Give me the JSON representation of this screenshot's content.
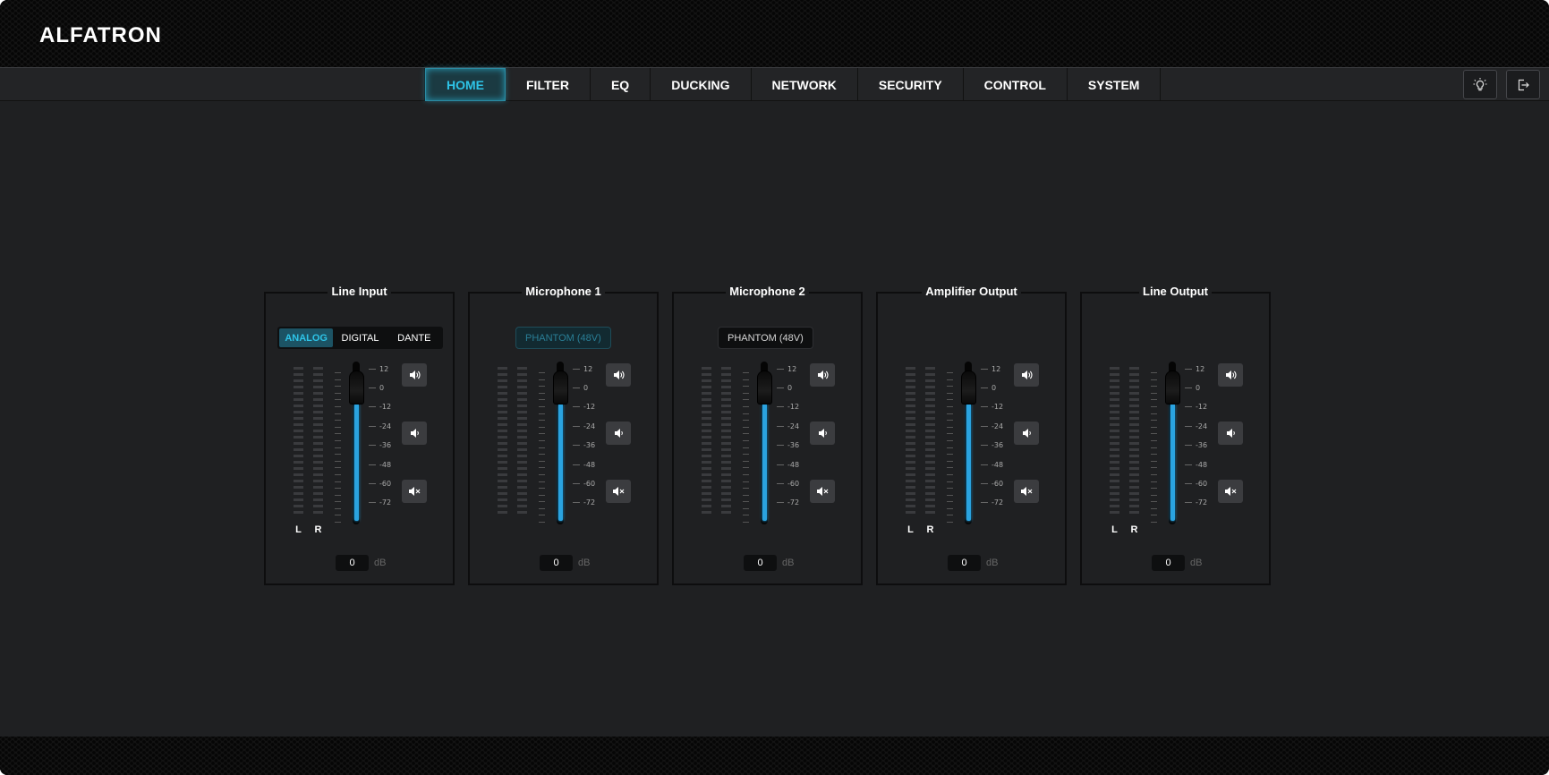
{
  "brand": {
    "logo": "ALFATRON"
  },
  "nav": {
    "items": [
      {
        "label": "HOME",
        "active": true
      },
      {
        "label": "FILTER",
        "active": false
      },
      {
        "label": "EQ",
        "active": false
      },
      {
        "label": "DUCKING",
        "active": false
      },
      {
        "label": "NETWORK",
        "active": false
      },
      {
        "label": "SECURITY",
        "active": false
      },
      {
        "label": "CONTROL",
        "active": false
      },
      {
        "label": "SYSTEM",
        "active": false
      }
    ],
    "actions": [
      {
        "icon": "lightbulb-icon"
      },
      {
        "icon": "logout-icon"
      }
    ]
  },
  "scale_labels": [
    "12",
    "0",
    "-12",
    "-24",
    "-36",
    "-48",
    "-60",
    "-72"
  ],
  "meter_labels": {
    "left": "L",
    "right": "R"
  },
  "db_unit": "dB",
  "volume_buttons": [
    {
      "icon": "volume-up-icon"
    },
    {
      "icon": "volume-down-icon"
    },
    {
      "icon": "mute-icon"
    }
  ],
  "accent_color": "#2ec4e8",
  "fader_color": "#2aa3e0",
  "channels": [
    {
      "title": "Line Input",
      "source_options": [
        "ANALOG",
        "DIGITAL",
        "DANTE"
      ],
      "selected_source": "ANALOG",
      "show_meters": true,
      "fader_level_db": 0,
      "gain_value": "0"
    },
    {
      "title": "Microphone 1",
      "phantom_label": "PHANTOM (48V)",
      "phantom_on": true,
      "show_meters": false,
      "fader_level_db": 0,
      "gain_value": "0"
    },
    {
      "title": "Microphone 2",
      "phantom_label": "PHANTOM (48V)",
      "phantom_on": false,
      "show_meters": false,
      "fader_level_db": 0,
      "gain_value": "0"
    },
    {
      "title": "Amplifier Output",
      "show_meters": true,
      "fader_level_db": 0,
      "gain_value": "0"
    },
    {
      "title": "Line Output",
      "show_meters": true,
      "fader_level_db": 0,
      "gain_value": "0"
    }
  ]
}
